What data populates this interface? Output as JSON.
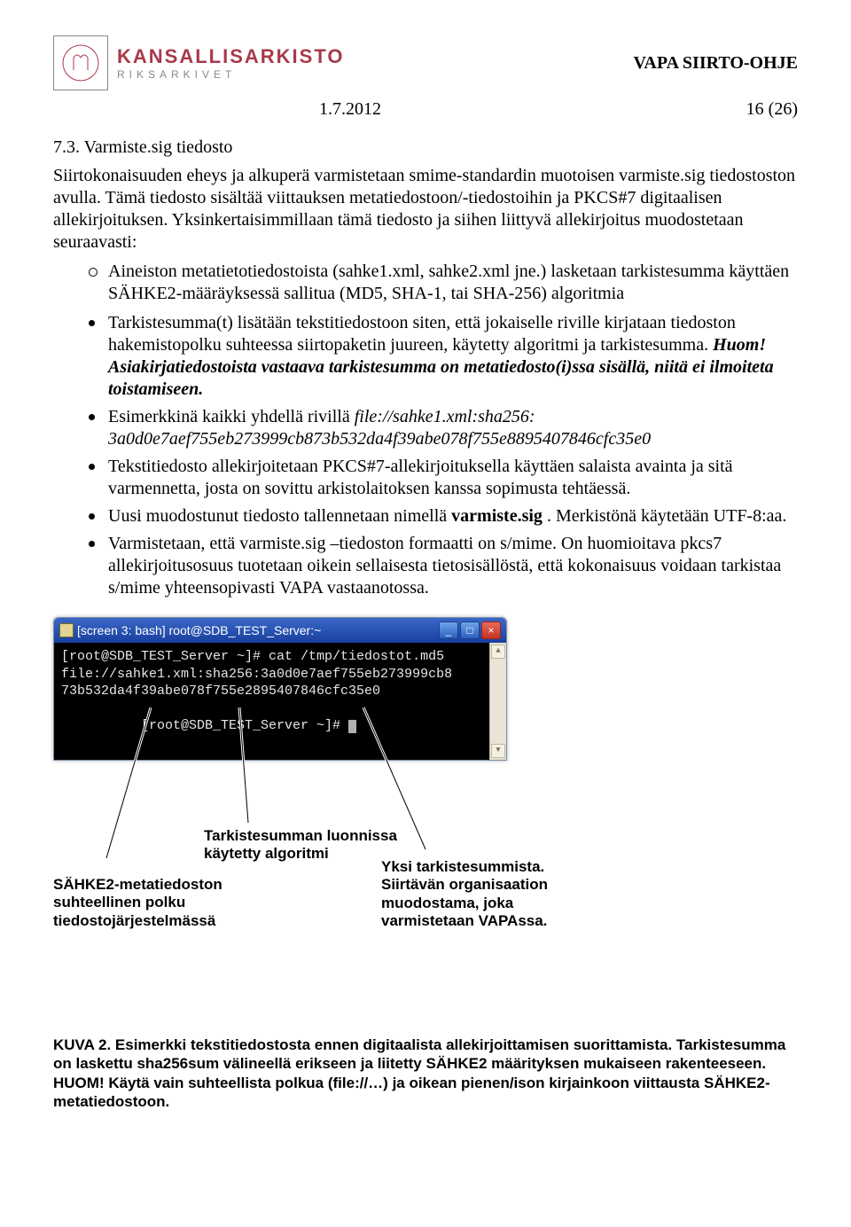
{
  "header": {
    "logo_line1": "KANSALLISARKISTO",
    "logo_line2": "RIKSARKIVET",
    "doc_title": "VAPA SIIRTO-OHJE",
    "date": "1.7.2012",
    "page": "16 (26)"
  },
  "section": {
    "number_title": "7.3.   Varmiste.sig tiedosto",
    "intro": "Siirtokonaisuuden eheys ja alkuperä varmistetaan smime-standardin muotoisen varmiste.sig tiedostoston avulla. Tämä tiedosto sisältää viittauksen metatiedostoon/-tiedostoihin ja PKCS#7 digitaalisen allekirjoituksen. Yksinkertaisimmillaan tämä tiedosto ja siihen liittyvä allekirjoitus muodostetaan seuraavasti:"
  },
  "sub_item_pre": "Aineiston metatietotiedostoista (sahke1.xml, sahke2.xml jne.) lasketaan tarkistesumma käyttäen SÄHKE2-määräyksessä sallitua (MD5, SHA-1, tai SHA-256) algoritmia",
  "bullets": {
    "b1_pre": "Tarkistesumma(t) lisätään tekstitiedostoon siten, että jokaiselle riville kirjataan tiedoston hakemistopolku suhteessa siirtopaketin juureen, käytetty algoritmi ja tarkistesumma. ",
    "b1_huom": "Huom!",
    "b1_post": " Asiakirjatiedostoista vastaava tarkistesumma on metatiedosto(i)ssa sisällä, niitä ei ilmoiteta toistamiseen.",
    "b2_pre": "Esimerkkinä kaikki yhdellä rivillä ",
    "b2_ital1": "file://sahke1.xml:sha256:",
    "b2_ital2": "3a0d0e7aef755eb273999cb873b532da4f39abe078f755e8895407846cfc35e0",
    "b3": "Tekstitiedosto allekirjoitetaan PKCS#7-allekirjoituksella käyttäen salaista avainta ja sitä varmennetta, josta on sovittu arkistolaitoksen kanssa sopimusta tehtäessä.",
    "b4_pre": "Uusi muodostunut tiedosto tallennetaan nimellä ",
    "b4_bold": "varmiste.sig",
    "b4_post": ". Merkistönä käytetään UTF-8:aa.",
    "b5": "Varmistetaan, että varmiste.sig –tiedoston formaatti on s/mime. On huomioitava pkcs7 allekirjoitusosuus tuotetaan oikein sellaisesta tietosisällöstä, että kokonaisuus voidaan tarkistaa s/mime yhteensopivasti VAPA vastaanotossa."
  },
  "terminal": {
    "title": "[screen 3: bash] root@SDB_TEST_Server:~",
    "line1": "[root@SDB_TEST_Server ~]# cat /tmp/tiedostot.md5",
    "line2": "file://sahke1.xml:sha256:3a0d0e7aef755eb273999cb8",
    "line3": "73b532da4f39abe078f755e2895407846cfc35e0",
    "line4": "[root@SDB_TEST_Server ~]# "
  },
  "annotations": {
    "a2": "Tarkistesumman luonnissa käytetty algoritmi",
    "a1": "SÄHKE2-metatiedoston suhteellinen polku tiedostojärjestelmässä",
    "a3": "Yksi tarkistesummista. Siirtävän organisaation muodostama, joka varmistetaan VAPAssa."
  },
  "caption": "KUVA 2. Esimerkki tekstitiedostosta ennen digitaalista allekirjoittamisen suorittamista. Tarkistesumma on laskettu sha256sum välineellä erikseen ja liitetty SÄHKE2 määrityksen mukaiseen rakenteeseen. HUOM! Käytä vain suhteellista polkua (file://…) ja oikean pienen/ison kirjainkoon viittausta SÄHKE2-metatiedostoon."
}
